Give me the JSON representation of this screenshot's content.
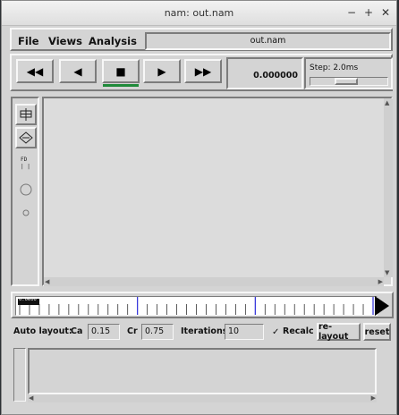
{
  "window": {
    "title": "nam: out.nam",
    "controls": {
      "minimize": "−",
      "maximize": "+",
      "close": "✕"
    }
  },
  "menu": {
    "items": [
      "File",
      "Views",
      "Analysis"
    ],
    "filename": "out.nam"
  },
  "toolbar": {
    "rewind": "◀◀",
    "back": "◀",
    "stop": "■",
    "play": "▶",
    "fast_forward": "▶▶",
    "time": "0.000000",
    "step_label": "Step: 2.0ms",
    "step_level": 0.45
  },
  "timeline": {
    "marker_label": "0.0e00"
  },
  "auto_layout": {
    "label": "Auto layout:",
    "ca_label": "Ca",
    "ca_value": "0.15",
    "cr_label": "Cr",
    "cr_value": "0.75",
    "iterations_label": "Iterations",
    "iterations_value": "10",
    "recalc_label": "Recalc",
    "recalc_checked": true,
    "relayout_label": "re-layout",
    "reset_label": "reset"
  },
  "colors": {
    "active_indicator": "#1f8a3a",
    "timeline_major_tick": "#2b2bd9"
  }
}
